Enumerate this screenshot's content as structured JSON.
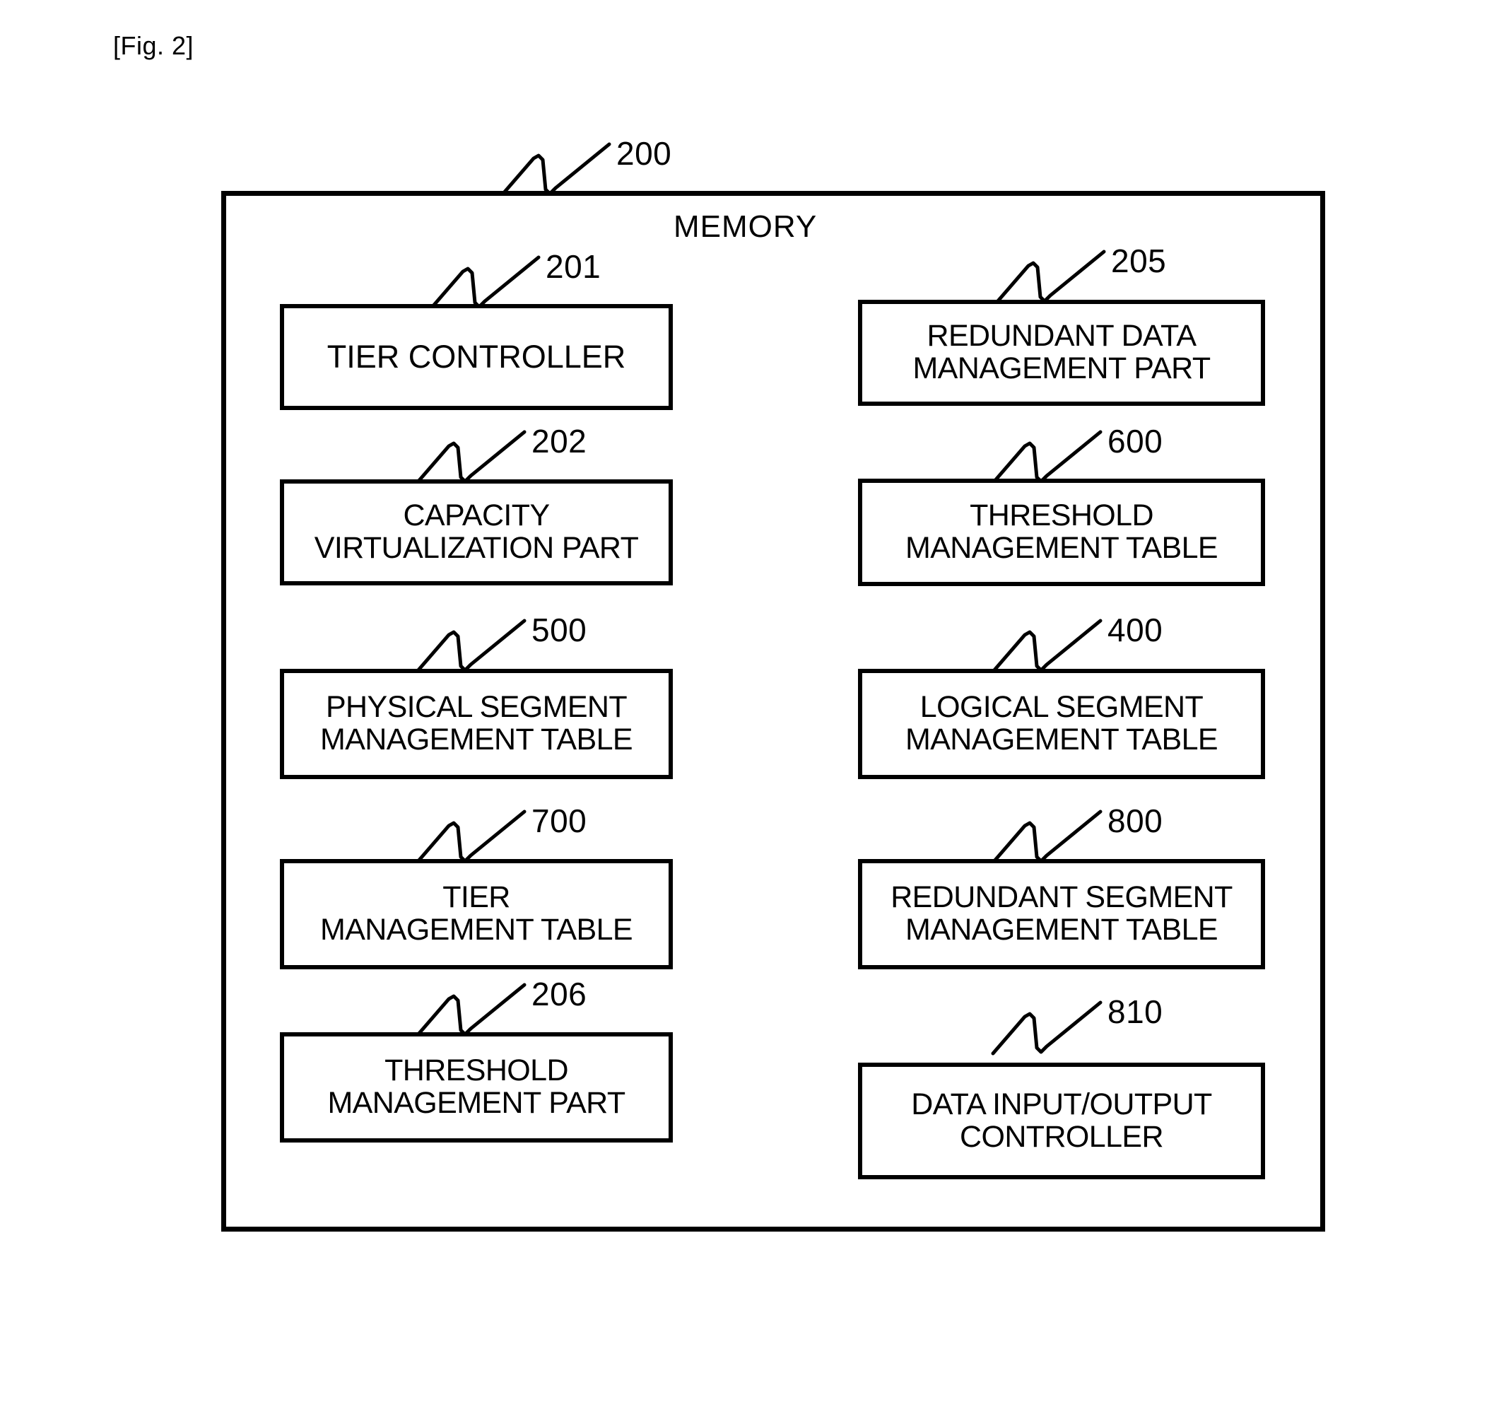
{
  "figure": {
    "label": "[Fig. 2]",
    "reference": "200",
    "title": "MEMORY"
  },
  "columns": {
    "left": [
      {
        "reference": "201",
        "lines": [
          "TIER CONTROLLER"
        ],
        "name": "tier-controller"
      },
      {
        "reference": "202",
        "lines": [
          "CAPACITY",
          "VIRTUALIZATION PART"
        ],
        "name": "capacity-virtualization-part"
      },
      {
        "reference": "500",
        "lines": [
          "PHYSICAL SEGMENT",
          "MANAGEMENT TABLE"
        ],
        "name": "physical-segment-management-table"
      },
      {
        "reference": "700",
        "lines": [
          "TIER",
          "MANAGEMENT TABLE"
        ],
        "name": "tier-management-table"
      },
      {
        "reference": "206",
        "lines": [
          "THRESHOLD",
          "MANAGEMENT PART"
        ],
        "name": "threshold-management-part"
      }
    ],
    "right": [
      {
        "reference": "205",
        "lines": [
          "REDUNDANT DATA",
          "MANAGEMENT PART"
        ],
        "name": "redundant-data-management-part"
      },
      {
        "reference": "600",
        "lines": [
          "THRESHOLD",
          "MANAGEMENT TABLE"
        ],
        "name": "threshold-management-table"
      },
      {
        "reference": "400",
        "lines": [
          "LOGICAL SEGMENT",
          "MANAGEMENT TABLE"
        ],
        "name": "logical-segment-management-table"
      },
      {
        "reference": "800",
        "lines": [
          "REDUNDANT SEGMENT",
          "MANAGEMENT TABLE"
        ],
        "name": "redundant-segment-management-table"
      },
      {
        "reference": "810",
        "lines": [
          "DATA INPUT/OUTPUT",
          "CONTROLLER"
        ],
        "name": "data-input-output-controller"
      }
    ]
  },
  "colors": {
    "background": "#ffffff",
    "stroke": "#000000",
    "text": "#000000"
  }
}
